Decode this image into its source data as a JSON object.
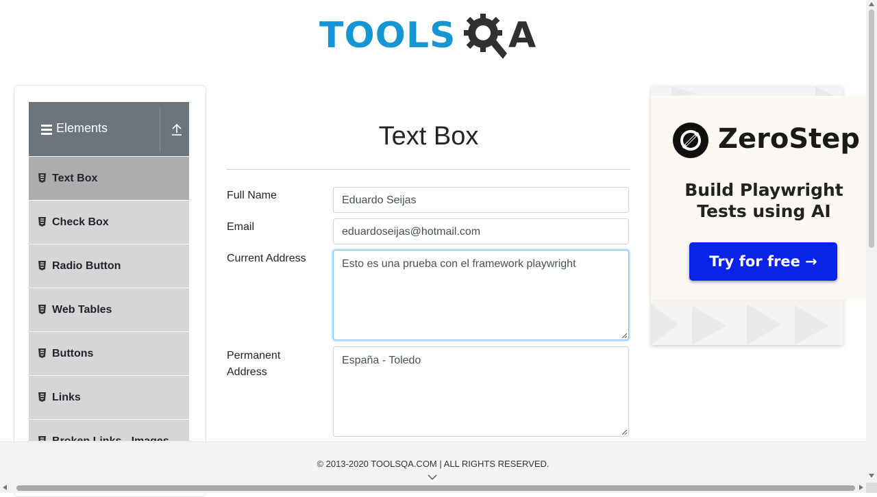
{
  "header": {
    "logo_main": "TOOLS",
    "logo_q": "Q",
    "logo_a": "A"
  },
  "sidebar": {
    "group_title": "Elements",
    "items": [
      {
        "label": "Text Box",
        "active": true
      },
      {
        "label": "Check Box",
        "active": false
      },
      {
        "label": "Radio Button",
        "active": false
      },
      {
        "label": "Web Tables",
        "active": false
      },
      {
        "label": "Buttons",
        "active": false
      },
      {
        "label": "Links",
        "active": false
      },
      {
        "label": "Broken Links - Images",
        "active": false
      }
    ]
  },
  "main": {
    "title": "Text Box",
    "full_name": {
      "label": "Full Name",
      "value": "Eduardo Seijas"
    },
    "email": {
      "label": "Email",
      "value": "eduardoseijas@hotmail.com"
    },
    "current_address": {
      "label": "Current Address",
      "value": "Esto es una prueba con el framework playwright"
    },
    "permanent_address": {
      "label_line1": "Permanent",
      "label_line2": "Address",
      "value": "España - Toledo"
    }
  },
  "ad": {
    "brand": "ZeroStep",
    "headline_line1": "Build Playwright",
    "headline_line2": "Tests using AI",
    "cta": "Try for free →"
  },
  "footer": {
    "copyright": "© 2013-2020 TOOLSQA.COM | ALL RIGHTS RESERVED."
  },
  "colors": {
    "logo_blue": "#1596d4",
    "logo_dark": "#2f3031",
    "sidebar_header": "#6c757d",
    "sidebar_item": "#d6d6d6",
    "sidebar_active": "#adadad",
    "ad_button": "#0a23e8"
  }
}
